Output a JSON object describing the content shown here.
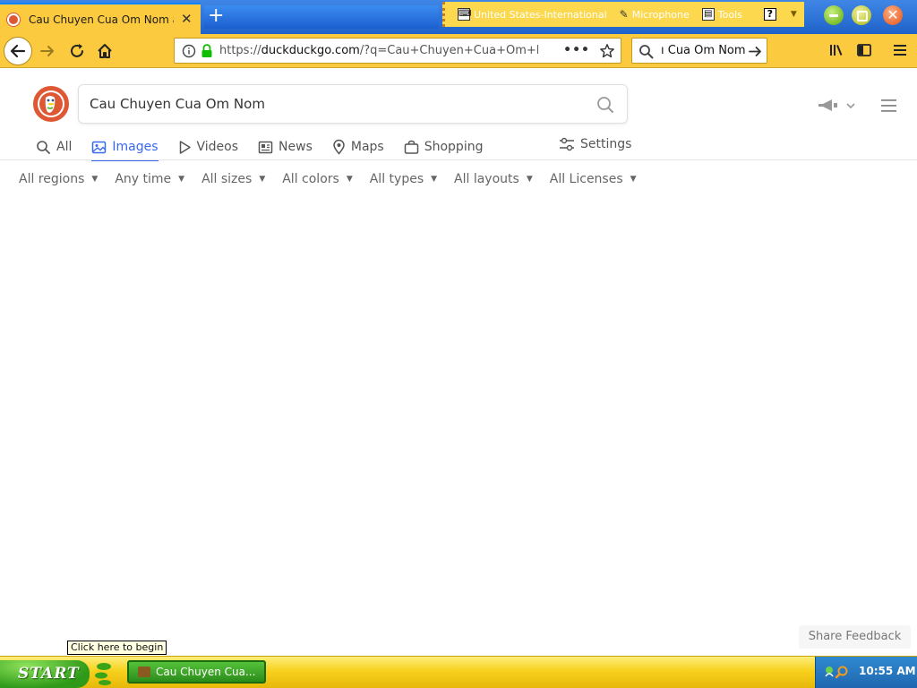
{
  "browser": {
    "tab": {
      "title": "Cau Chuyen Cua Om Nom a"
    },
    "new_tab_label": "+",
    "url": {
      "prefix": "https://",
      "host": "duckduckgo.com",
      "rest": "/?q=Cau+Chuyen+Cua+Om+N"
    },
    "url_more": "•••",
    "search_value": "ı Cua Om Nom"
  },
  "langbar": {
    "items": [
      {
        "label": "United States-International",
        "icon": "keyboard-icon"
      },
      {
        "label": "Microphone",
        "icon": "microphone-icon"
      },
      {
        "label": "Tools",
        "icon": "tools-icon"
      }
    ],
    "help": "?"
  },
  "ddg": {
    "query": "Cau Chuyen Cua Om Nom",
    "tabs": [
      {
        "label": "All",
        "icon": "search-icon",
        "active": false
      },
      {
        "label": "Images",
        "icon": "image-icon",
        "active": true
      },
      {
        "label": "Videos",
        "icon": "play-icon",
        "active": false
      },
      {
        "label": "News",
        "icon": "news-icon",
        "active": false
      },
      {
        "label": "Maps",
        "icon": "map-pin-icon",
        "active": false
      },
      {
        "label": "Shopping",
        "icon": "shopping-bag-icon",
        "active": false
      }
    ],
    "settings_label": "Settings",
    "filters": [
      "All regions",
      "Any time",
      "All sizes",
      "All colors",
      "All types",
      "All layouts",
      "All Licenses"
    ],
    "feedback": "Share Feedback"
  },
  "os": {
    "tooltip": "Click here to begin",
    "start_label": "START",
    "task_label": "Cau Chuyen Cua...",
    "clock": "10:55 AM"
  },
  "colors": {
    "accent": "#3969ef",
    "ddg_orange": "#de5833",
    "toolbar": "#fbca3f"
  }
}
